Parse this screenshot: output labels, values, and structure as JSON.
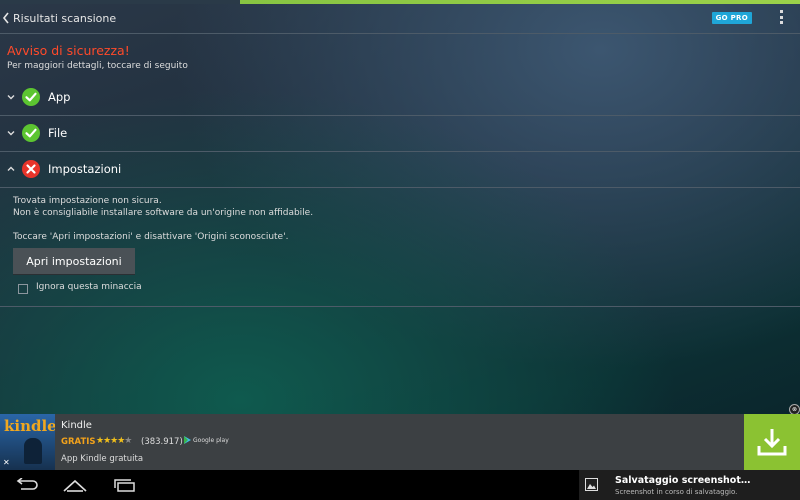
{
  "header": {
    "back_label": "Risultati scansione",
    "gopro_label": "GO PRO"
  },
  "warning": {
    "title": "Avviso di sicurezza!",
    "subtitle": "Per maggiori dettagli, toccare di seguito"
  },
  "sections": [
    {
      "label": "App",
      "status": "ok",
      "expanded": false
    },
    {
      "label": "File",
      "status": "ok",
      "expanded": false
    },
    {
      "label": "Impostazioni",
      "status": "error",
      "expanded": true
    }
  ],
  "settings_detail": {
    "line1": "Trovata impostazione non sicura.",
    "line2": "Non è consigliabile installare software da un'origine non affidabile.",
    "line3": "Toccare 'Apri impostazioni' e disattivare 'Origini sconosciute'.",
    "button_label": "Apri impostazioni",
    "ignore_label": "Ignora questa minaccia",
    "ignore_checked": false
  },
  "ad": {
    "thumb_text": "kindle",
    "thumb_close": "✕",
    "app_name": "Kindle",
    "price": "GRATIS",
    "stars_filled": "★★★★",
    "stars_empty": "★",
    "rating_count": "(383.917)",
    "store_label": "Google play",
    "description": "App Kindle gratuita",
    "close_label": "⊗"
  },
  "notification": {
    "title": "Salvataggio screenshot…",
    "subtitle": "Screenshot in corso di salvataggio."
  },
  "colors": {
    "warning_red": "#ff4a2a",
    "ok_green": "#5cc531",
    "error_red": "#e8342a",
    "gopro_blue": "#1fa6d8",
    "download_green": "#8bc232"
  }
}
